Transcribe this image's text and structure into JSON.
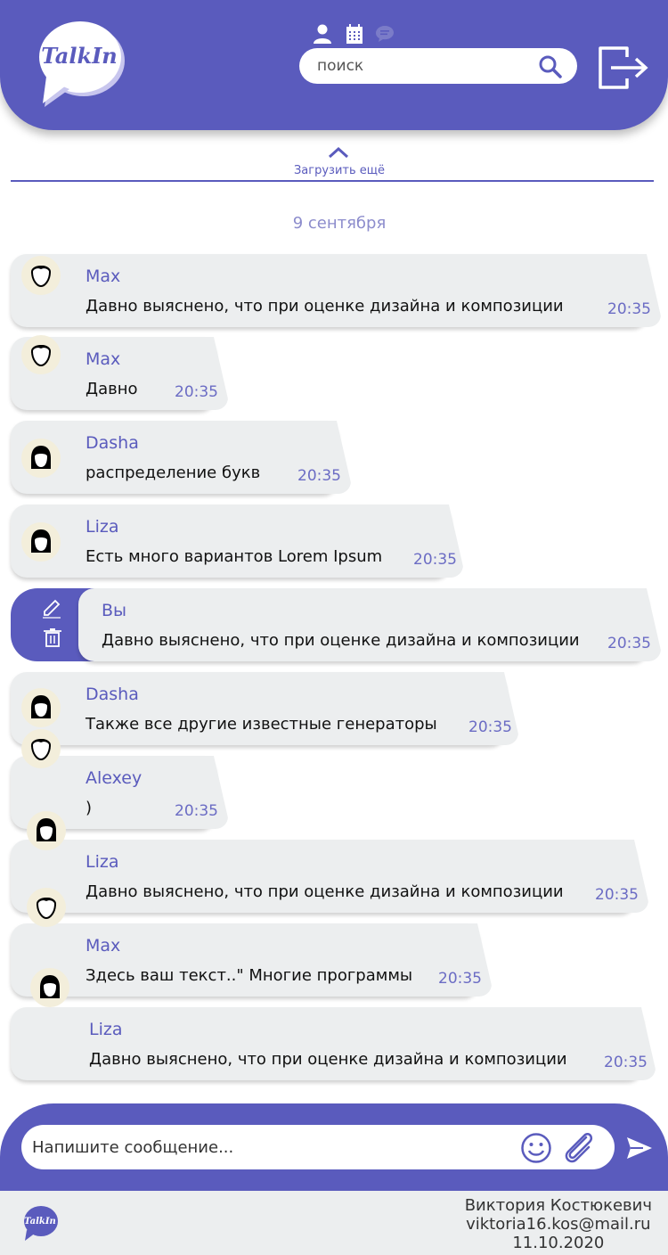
{
  "app": {
    "name": "TalkIn"
  },
  "search": {
    "placeholder": "поиск"
  },
  "load_more": {
    "label": "Загрузить ещё"
  },
  "date_separator": "9 сентября",
  "messages": [
    {
      "author": "Max",
      "text": "Давно выяснено, что при оценке дизайна и композиции",
      "time": "20:35"
    },
    {
      "author": "Max",
      "text": "Давно",
      "time": "20:35"
    },
    {
      "author": "Dasha",
      "text": "распределение букв",
      "time": "20:35"
    },
    {
      "author": "Liza",
      "text": "Есть много вариантов Lorem Ipsum",
      "time": "20:35"
    },
    {
      "author": "Вы",
      "text": "Давно выяснено, что при оценке дизайна и композиции",
      "time": "20:35"
    },
    {
      "author": "Dasha",
      "text": "Также все другие известные генераторы",
      "time": "20:35"
    },
    {
      "author": "Alexey",
      "text": ")",
      "time": "20:35"
    },
    {
      "author": "Liza",
      "text": "Давно выяснено, что при оценке дизайна и композиции",
      "time": "20:35"
    },
    {
      "author": "Max",
      "text": "Здесь ваш текст..\" Многие программы",
      "time": "20:35"
    },
    {
      "author": "Liza",
      "text": "Давно выяснено, что при оценке дизайна и композиции",
      "time": "20:35"
    }
  ],
  "composer": {
    "placeholder": "Напишите сообщение..."
  },
  "footer": {
    "author": "Виктория Костюкевич",
    "email": "viktoria16.kos@mail.ru",
    "date": "11.10.2020"
  },
  "colors": {
    "brand": "#5a5bbd",
    "bubble": "#eceeef",
    "accent_text": "#5a5bbd"
  }
}
